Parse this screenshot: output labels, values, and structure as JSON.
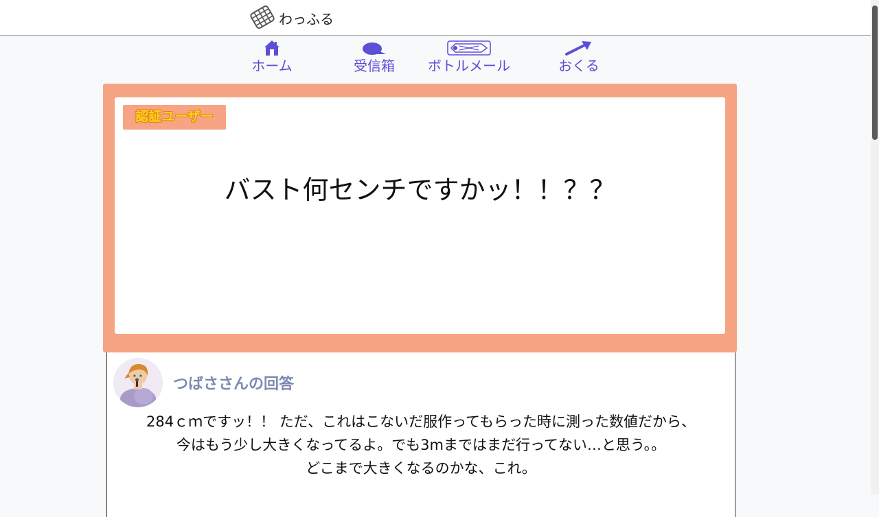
{
  "header": {
    "logo_text": "わっふる",
    "logo_icon": "waffle-icon"
  },
  "nav": {
    "items": [
      {
        "label": "ホーム",
        "icon": "home-icon"
      },
      {
        "label": "受信箱",
        "icon": "speech-bubble-icon"
      },
      {
        "label": "ボトルメール",
        "icon": "bottle-mail-icon"
      },
      {
        "label": "おくる",
        "icon": "send-arrow-icon"
      }
    ],
    "color": "#5b4fd6"
  },
  "question": {
    "badge": "認証ユーザー",
    "text": "バスト何センチですかッ！！？？",
    "frame_color": "#f7a484"
  },
  "answer": {
    "answerer": "つばささんの回答",
    "lines": [
      "284ｃｍですッ！！ ただ、これはこないだ服作ってもらった時に測った数値だから、",
      "今はもう少し大きくなってるよ。でも3mまではまだ行ってない…と思う。。",
      "どこまで大きくなるのかな、これ。"
    ]
  }
}
